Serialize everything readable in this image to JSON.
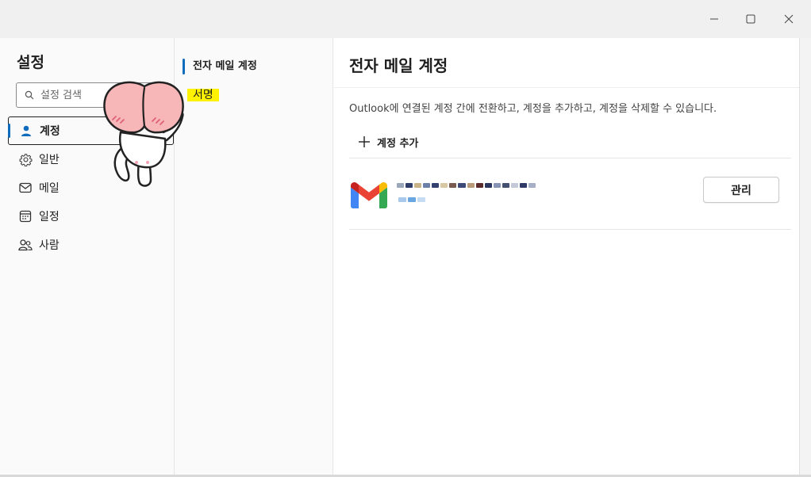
{
  "window": {
    "controls": [
      "minimize-icon",
      "maximize-icon",
      "close-icon"
    ]
  },
  "settings": {
    "title": "설정",
    "search_placeholder": "설정 검색",
    "nav": [
      {
        "label": "계정",
        "icon": "person-icon",
        "active": true
      },
      {
        "label": "일반",
        "icon": "gear-icon",
        "active": false
      },
      {
        "label": "메일",
        "icon": "mail-icon",
        "active": false
      },
      {
        "label": "일정",
        "icon": "calendar-icon",
        "active": false
      },
      {
        "label": "사람",
        "icon": "people-icon",
        "active": false
      }
    ]
  },
  "subnav": {
    "items": [
      {
        "label": "전자 메일 계정",
        "active": true
      },
      {
        "label": "서명",
        "active": false,
        "highlight": "#fff200"
      }
    ]
  },
  "main": {
    "title": "전자 메일 계정",
    "description": "Outlook에 연결된 계정 간에 전환하고, 계정을 추가하고, 계정을 삭제할 수 있습니다.",
    "add_account_label": "계정 추가",
    "accounts": [
      {
        "provider_icon": "gmail-icon",
        "email": "",
        "manage_label": "관리"
      }
    ]
  },
  "colors": {
    "accent": "#0f6cbd",
    "highlight": "#fff200"
  }
}
